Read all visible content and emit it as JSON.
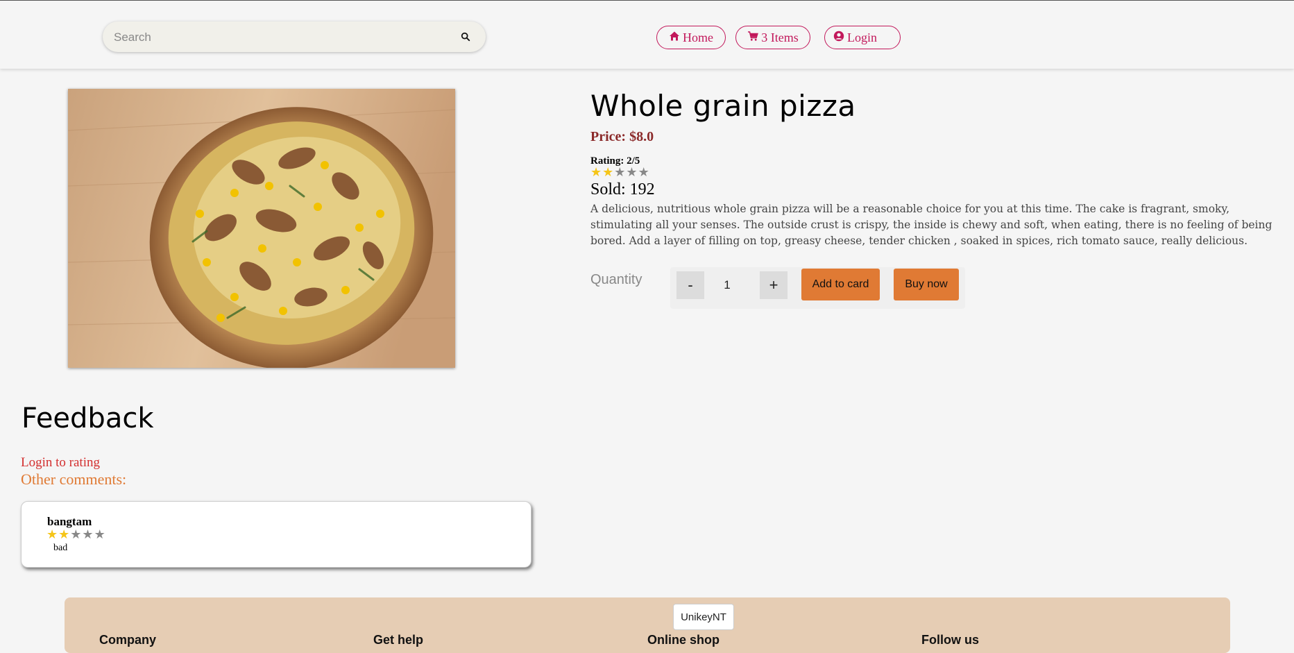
{
  "header": {
    "search_placeholder": "Search",
    "nav": {
      "home": "Home",
      "cart": "3 Items",
      "login": "Login"
    }
  },
  "product": {
    "title": "Whole grain pizza",
    "price": "Price: $8.0",
    "rating_label": "Rating: 2/5",
    "rating": 2,
    "rating_max": 5,
    "sold": "Sold: 192",
    "description": "A delicious, nutritious whole grain pizza will be a reasonable choice for you at this time. The cake is fragrant, smoky, stimulating all your senses. The outside crust is crispy, the inside is chewy and soft, when eating, there is no feeling of being bored. Add a layer of filling on top, greasy cheese, tender chicken , soaked in spices, rich tomato sauce, really delicious.",
    "quantity_label": "Quantity",
    "quantity_value": "1",
    "minus_label": "-",
    "plus_label": "+",
    "add_to_cart_label": "Add to card",
    "buy_now_label": "Buy now"
  },
  "feedback": {
    "title": "Feedback",
    "login_to_rate": "Login to rating",
    "other_comments": "Other comments:",
    "comments": [
      {
        "user": "bangtam",
        "rating": 2,
        "text": "bad"
      }
    ]
  },
  "footer": {
    "badge": "UnikeyNT",
    "columns": [
      "Company",
      "Get help",
      "Online shop",
      "Follow us"
    ]
  },
  "colors": {
    "accent_nav": "#c2185b",
    "price": "#8b2a2a",
    "action_button": "#e07a34",
    "star_on": "#f5c518",
    "login_to_rate": "#d32f2f",
    "footer_bg": "#e6cdb4"
  },
  "icons": {
    "search": "search-icon",
    "home": "home-icon",
    "cart": "cart-icon",
    "login": "user-circle-icon"
  }
}
